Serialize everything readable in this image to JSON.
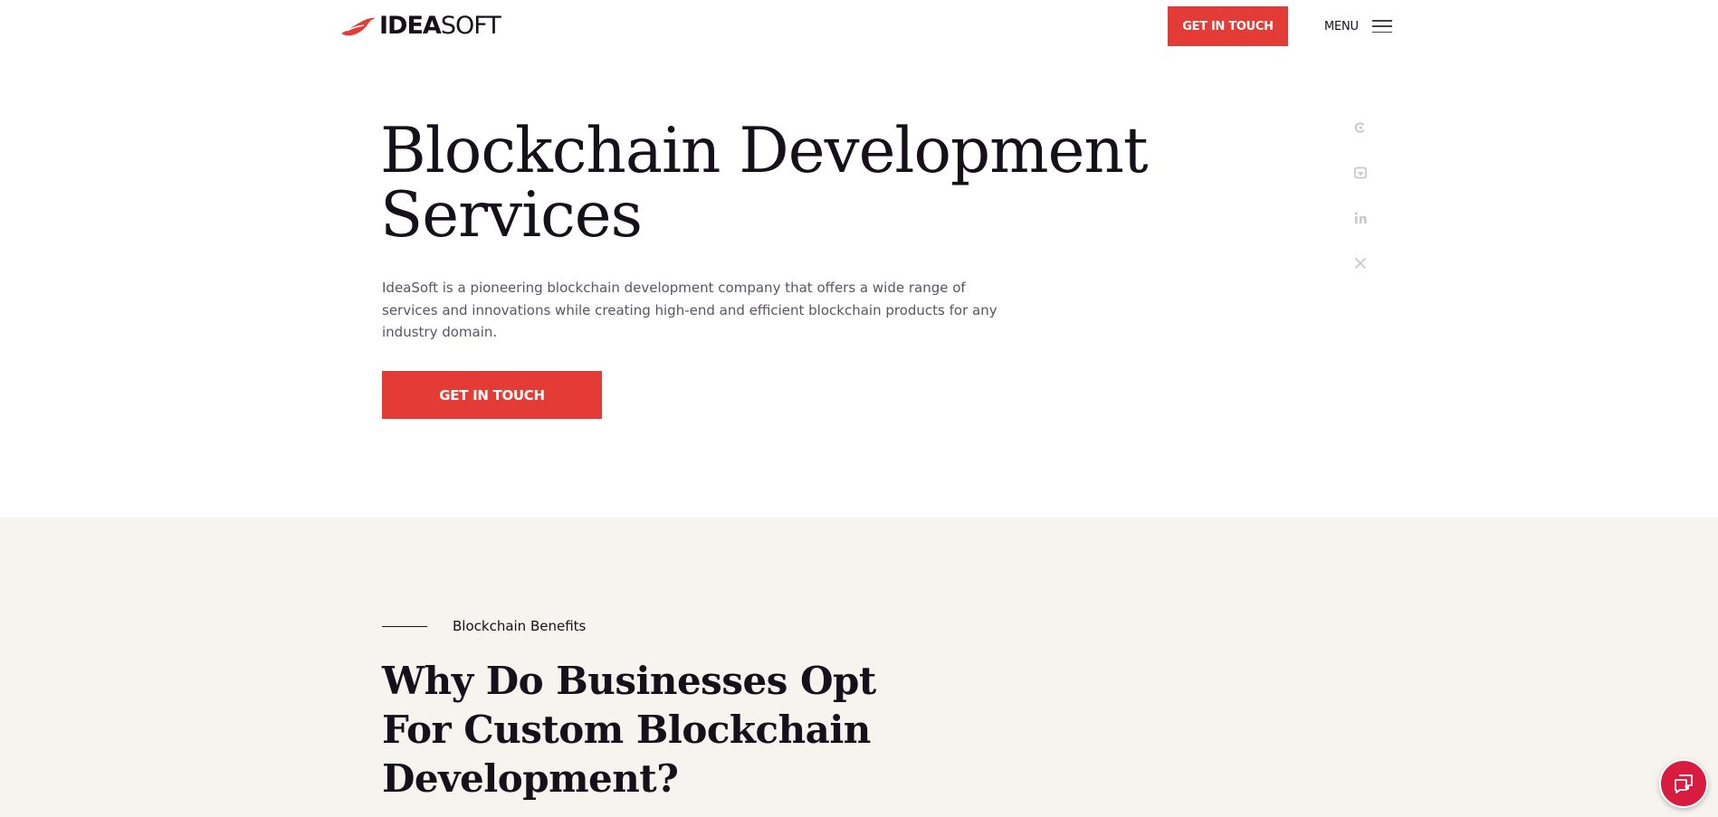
{
  "header": {
    "logo": {
      "bold": "IDEA",
      "light": "SOFT"
    },
    "cta_label": "GET IN TOUCH",
    "menu_label": "MENU"
  },
  "hero": {
    "title_line1": "Blockchain Development",
    "title_line2": "Services",
    "description": "IdeaSoft is a pioneering blockchain development company that offers a wide range of services and innovations while creating high-end and efficient blockchain products for any industry domain.",
    "cta_label": "GET IN TOUCH"
  },
  "social": [
    {
      "icon": "clutch-icon"
    },
    {
      "icon": "goodfirms-icon"
    },
    {
      "icon": "linkedin-icon"
    },
    {
      "icon": "x-icon"
    }
  ],
  "benefits": {
    "eyebrow": "Blockchain Benefits",
    "title_line1": "Why Do Businesses Opt",
    "title_line2": "For Custom Blockchain",
    "title_line3": "Development?"
  },
  "chat": {
    "icon": "chat-icon"
  },
  "colors": {
    "accent": "#e43b36",
    "chat": "#d81c40",
    "section_bg": "#f7f4f0",
    "text": "#15101a",
    "muted": "#5a5560",
    "social_icon": "#c8c8c8"
  }
}
